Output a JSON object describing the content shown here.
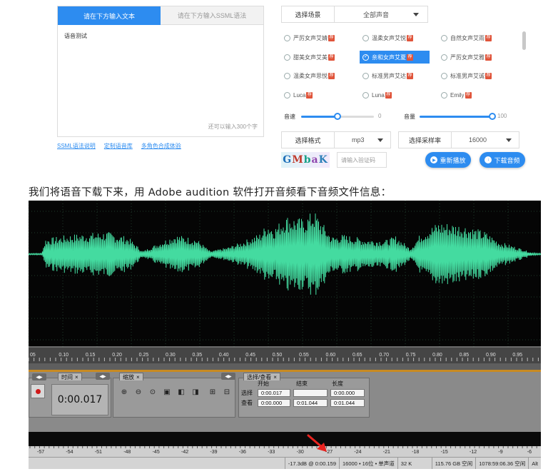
{
  "text_panel": {
    "tab_text": "请在下方输入文本",
    "tab_ssml": "请在下方输入SSML语法",
    "content": "语音测试",
    "char_hint": "还可以输入300个字"
  },
  "links": [
    "SSML语法说明",
    "定制语音库",
    "多角色合成体验"
  ],
  "scene": {
    "label": "选择场景",
    "value": "全部声音"
  },
  "voices": [
    {
      "name": "严厉女声艾婧",
      "selected": false
    },
    {
      "name": "温柔女声艾悦",
      "selected": false
    },
    {
      "name": "自然女声艾雨",
      "selected": false
    },
    {
      "name": "甜美女声艾美",
      "selected": false
    },
    {
      "name": "亲和女声艾夏",
      "selected": true
    },
    {
      "name": "严厉女声艾雅",
      "selected": false
    },
    {
      "name": "温柔女声思悦",
      "selected": false
    },
    {
      "name": "标准男声艾达",
      "selected": false
    },
    {
      "name": "标准男声艾诚",
      "selected": false
    },
    {
      "name": "Luca",
      "selected": false
    },
    {
      "name": "Luna",
      "selected": false
    },
    {
      "name": "Emily",
      "selected": false
    }
  ],
  "voice_tag": "荐",
  "speed": {
    "label": "音速",
    "value": "0",
    "level": 0.5
  },
  "volume": {
    "label": "音量",
    "value": "100",
    "level": 1.0
  },
  "format": {
    "label": "选择格式",
    "value": "mp3"
  },
  "sample_rate": {
    "label": "选择采样率",
    "value": "16000"
  },
  "captcha": {
    "image_text": "GMbaK",
    "placeholder": "请输入验证码"
  },
  "replay_button": "重新播放",
  "download_button": "下载音频",
  "article_text": "我们将语音下载下来，用 Adobe audition 软件打开音频看下音频文件信息：",
  "audition": {
    "time_ticks": [
      "05",
      "0.10",
      "0.15",
      "0.20",
      "0.25",
      "0.30",
      "0.35",
      "0.40",
      "0.45",
      "0.50",
      "0.55",
      "0.60",
      "0.65",
      "0.70",
      "0.75",
      "0.80",
      "0.85",
      "0.90",
      "0.95"
    ],
    "time_panel_tab": "时间",
    "time_value": "0:00.017",
    "zoom_panel_tab": "缩放",
    "selection_panel_tab": "选择/查看",
    "col_start": "开始",
    "col_end": "结束",
    "col_length": "长度",
    "row_select": "选择",
    "row_view": "查看",
    "select_start": "0:00.017",
    "select_end": "",
    "select_length": "0:00.000",
    "view_start": "0:00.000",
    "view_end": "0:01.044",
    "view_length": "0:01.044",
    "db_ticks": [
      "-57",
      "-54",
      "-51",
      "-48",
      "-45",
      "-42",
      "-39",
      "-36",
      "-33",
      "-30",
      "-27",
      "-24",
      "-21",
      "-18",
      "-15",
      "-12",
      "-9",
      "-6"
    ],
    "status": [
      "-17.3dB @ 0:00.159",
      "16000 • 16位 • 单声道",
      "32 K",
      "115.76 GB 空闲",
      "1078:59:06.36 空闲",
      "Alt"
    ],
    "wave_color": "#44dba0"
  }
}
